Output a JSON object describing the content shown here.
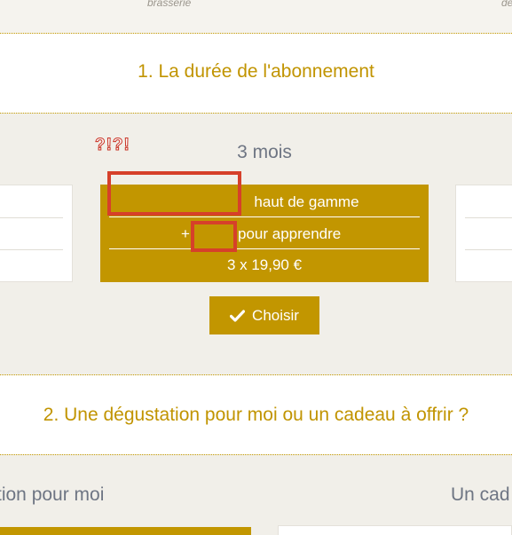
{
  "header": {
    "left_word": "brasserie",
    "right_word": "dé"
  },
  "duration": {
    "title": "1. La durée de l'abonnement",
    "plan": {
      "name": "3 mois",
      "row1": "haut de gamme",
      "row2_prefix": "+",
      "row2_suffix": "pour apprendre",
      "price": "3 x 19,90 €"
    },
    "annotation": "?!?!",
    "choose_label": "Choisir"
  },
  "gift": {
    "title": "2. Une dégustation pour moi ou un cadeau à offrir ?",
    "option_left": "tion pour moi",
    "option_right": "Un cad"
  },
  "colors": {
    "accent": "#c29600",
    "title_gold": "#c19400",
    "annotation_red": "#d6402a",
    "text_gray": "#6e7583"
  },
  "icons": {
    "choose_button": "check-icon"
  }
}
